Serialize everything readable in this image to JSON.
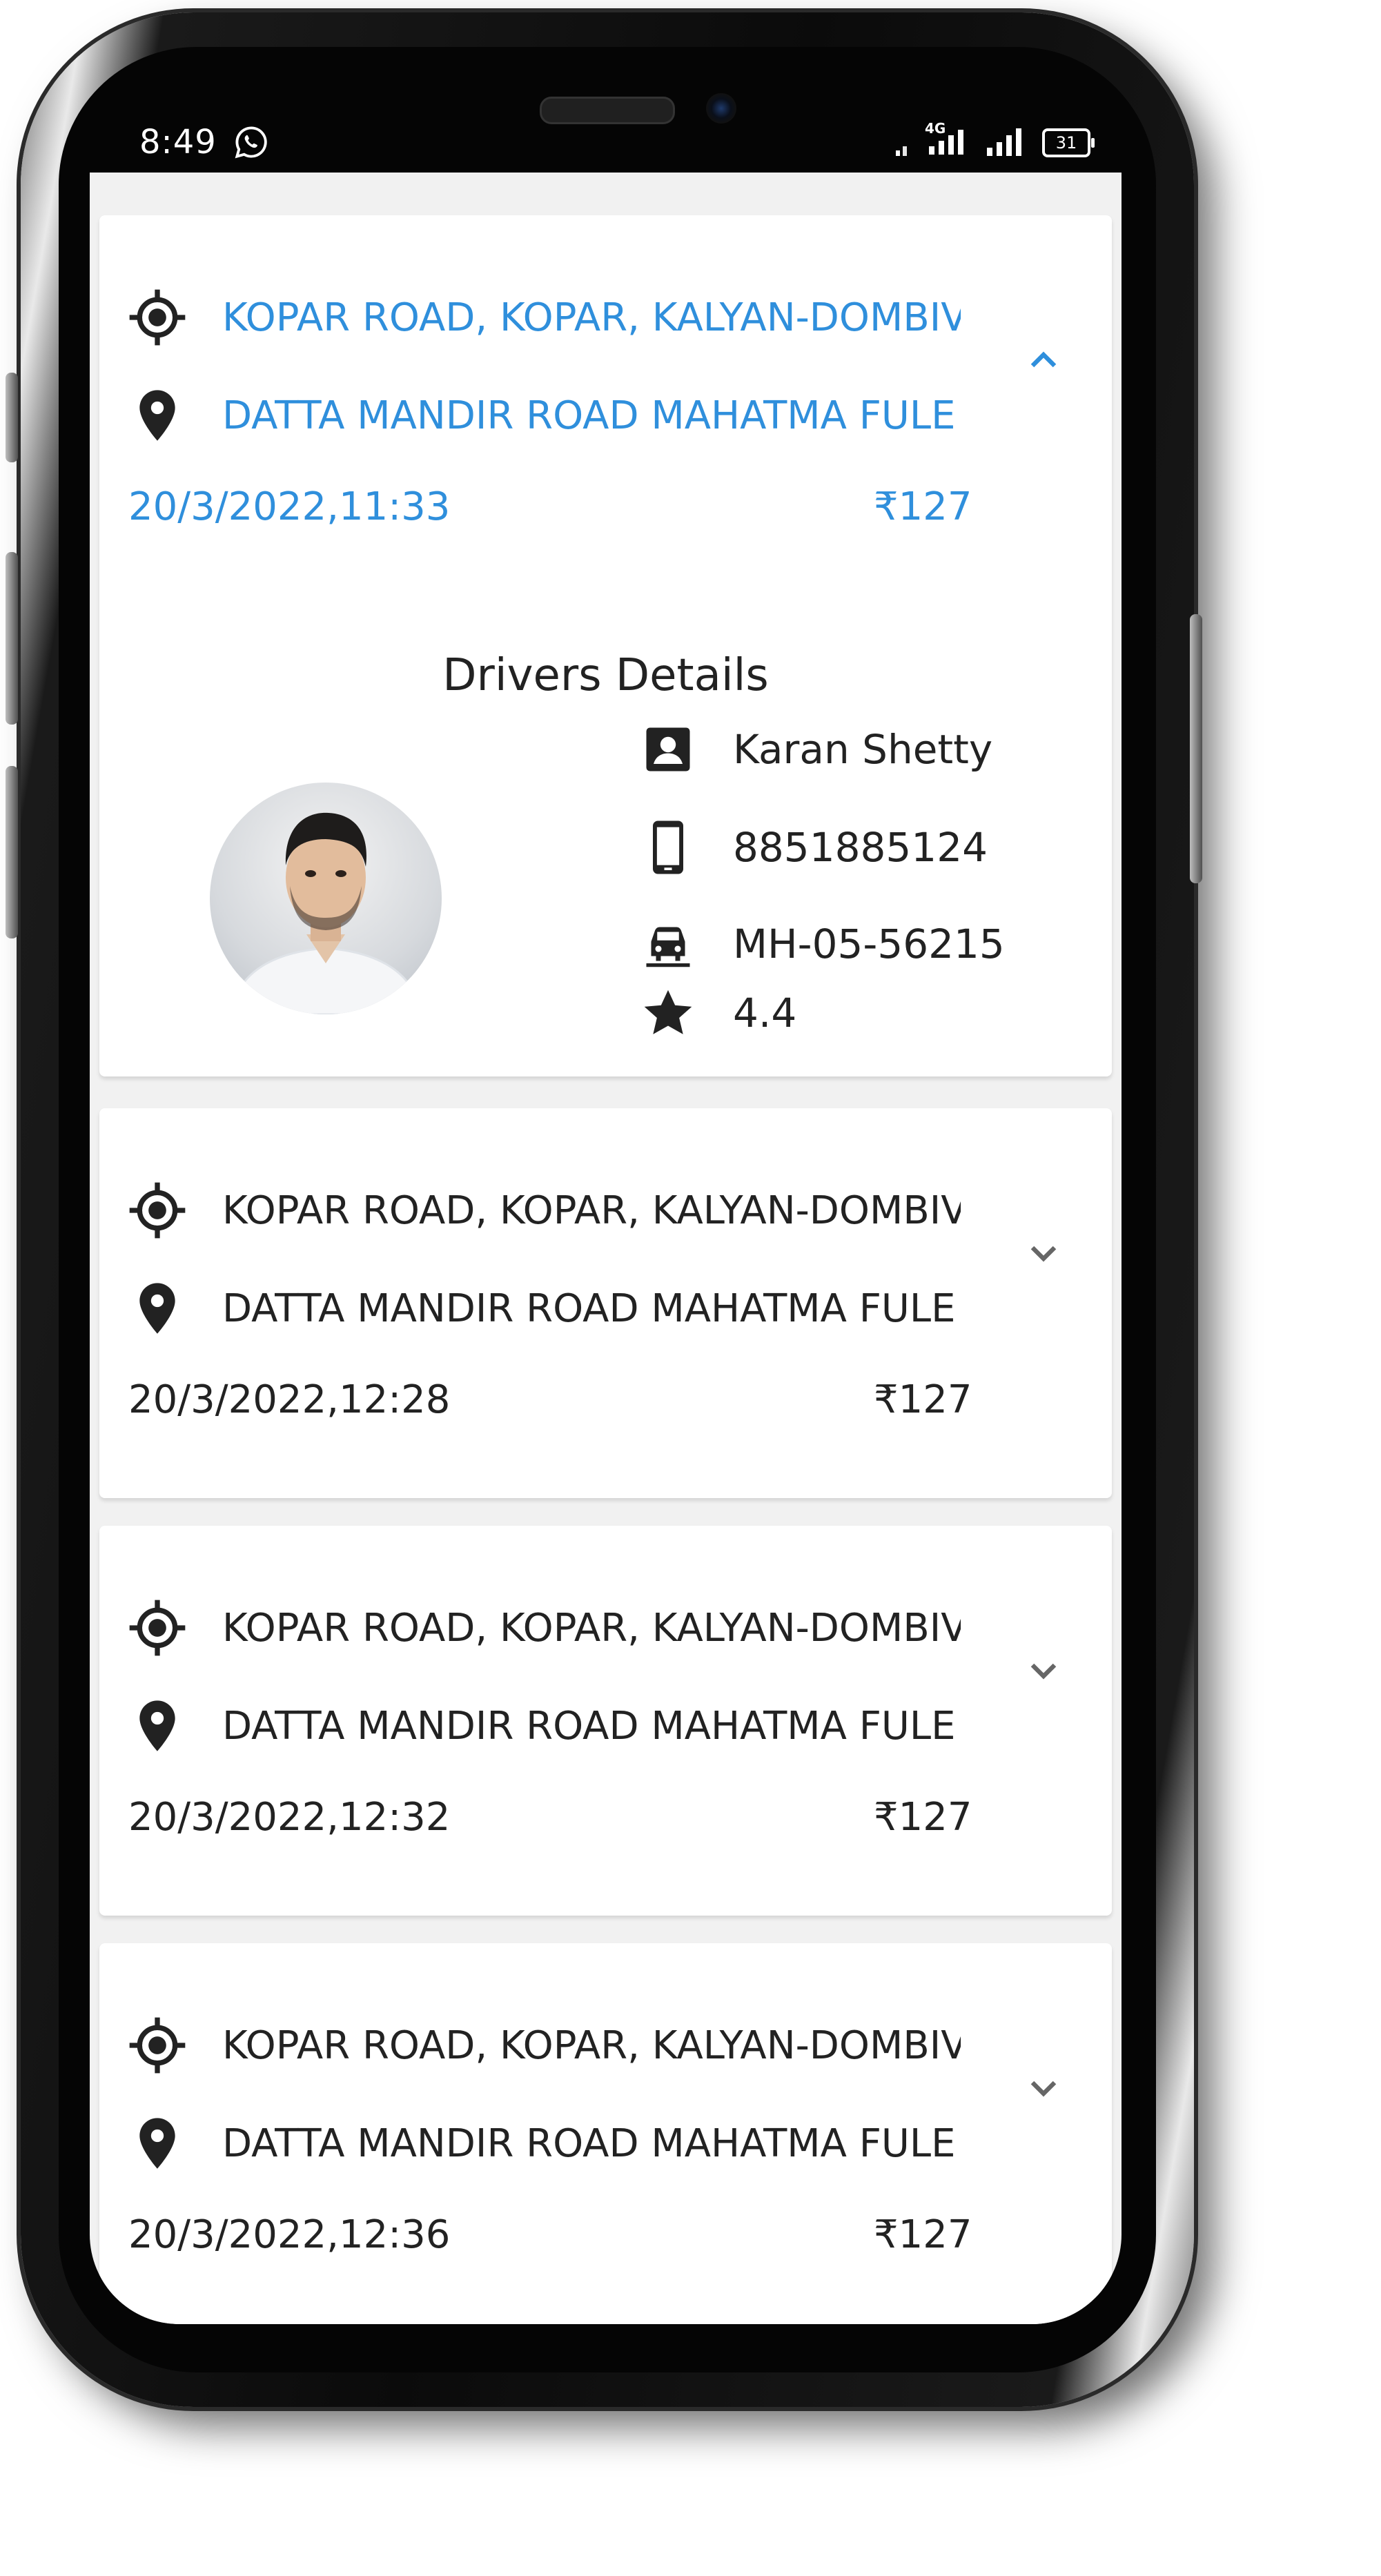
{
  "status_bar": {
    "time": "8:49",
    "network": "4G",
    "battery": "31"
  },
  "rides": [
    {
      "pickup": "KOPAR ROAD, KOPAR, KALYAN-DOMBIVLI",
      "drop": "DATTA MANDIR ROAD MAHATMA FULE",
      "datetime": "20/3/2022,11:33",
      "fare": "₹127",
      "expanded": true
    },
    {
      "pickup": "KOPAR ROAD, KOPAR, KALYAN-DOMBIVLI",
      "drop": "DATTA MANDIR ROAD MAHATMA FULE",
      "datetime": "20/3/2022,12:28",
      "fare": "₹127",
      "expanded": false
    },
    {
      "pickup": "KOPAR ROAD, KOPAR, KALYAN-DOMBIVLI",
      "drop": "DATTA MANDIR ROAD MAHATMA FULE",
      "datetime": "20/3/2022,12:32",
      "fare": "₹127",
      "expanded": false
    },
    {
      "pickup": "KOPAR ROAD, KOPAR, KALYAN-DOMBIVLI",
      "drop": "DATTA MANDIR ROAD MAHATMA FULE",
      "datetime": "20/3/2022,12:36",
      "fare": "₹127",
      "expanded": false
    }
  ],
  "driver_details": {
    "title": "Drivers Details",
    "name": "Karan Shetty",
    "phone": "8851885124",
    "vehicle": "MH-05-56215",
    "rating": "4.4"
  },
  "colors": {
    "accent": "#2f8fdc",
    "text": "#222222",
    "card": "#ffffff",
    "screen_bg": "#f1f1f1"
  },
  "icons": {
    "pickup": "gps-target-icon",
    "drop": "location-pin-icon",
    "collapse": "chevron-up-icon",
    "expand": "chevron-down-icon",
    "driver_name": "contact-card-icon",
    "driver_phone": "mobile-phone-icon",
    "driver_vehicle": "car-icon",
    "driver_rating": "star-icon"
  }
}
